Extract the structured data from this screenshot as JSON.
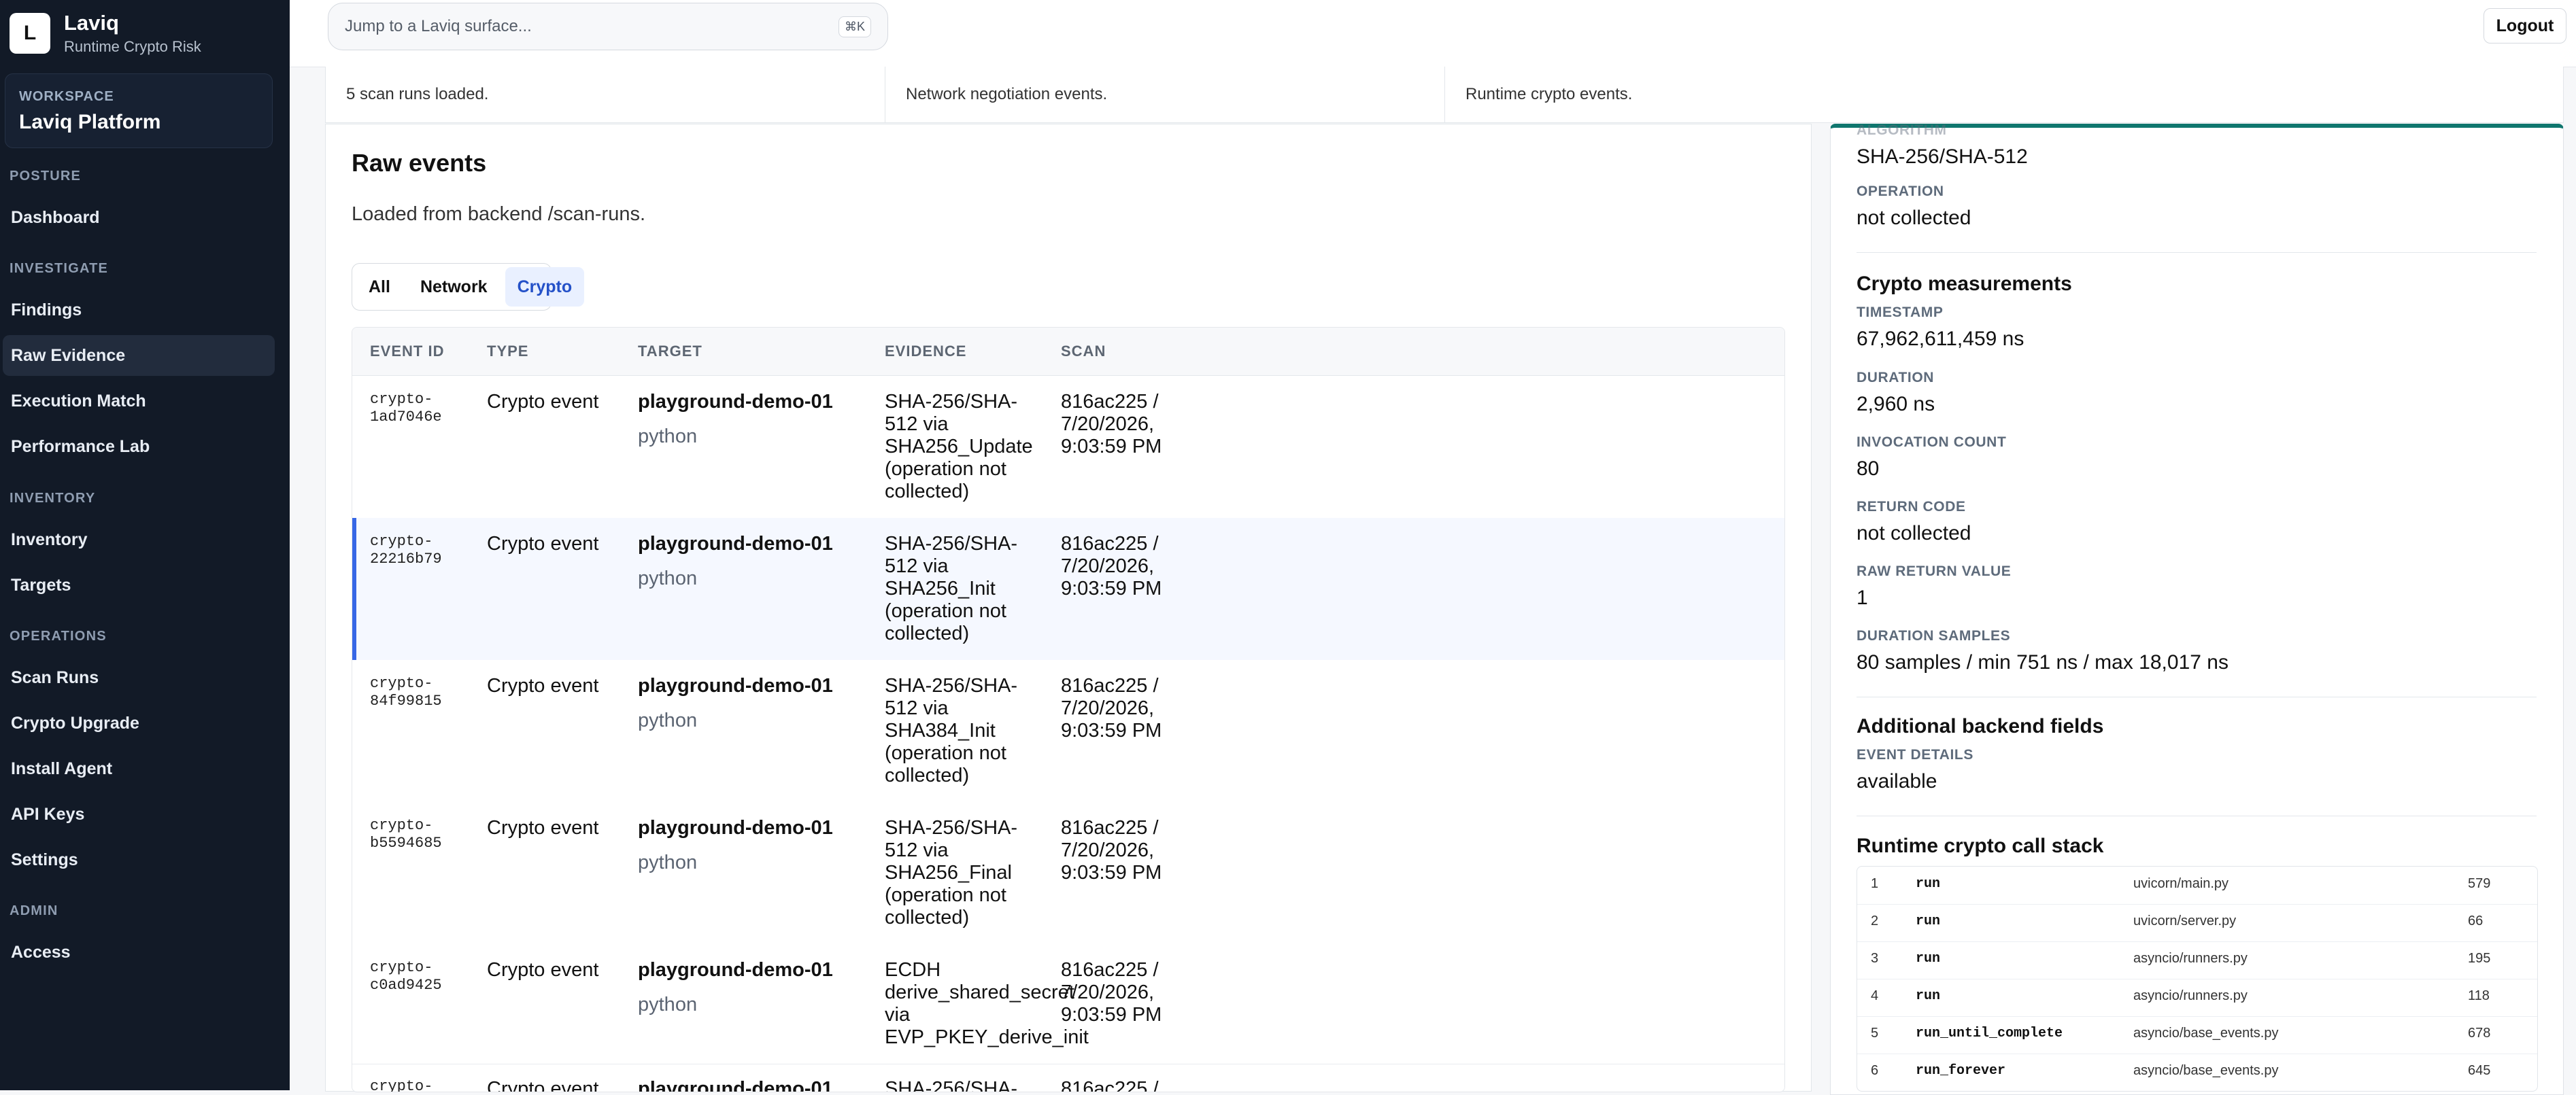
{
  "brand": {
    "logo_letter": "L",
    "name": "Laviq",
    "subtitle": "Runtime Crypto Risk"
  },
  "workspace": {
    "label": "WORKSPACE",
    "name": "Laviq Platform"
  },
  "sidebar": {
    "sections": [
      {
        "label": "POSTURE",
        "items": [
          {
            "label": "Dashboard"
          }
        ]
      },
      {
        "label": "INVESTIGATE",
        "items": [
          {
            "label": "Findings"
          },
          {
            "label": "Raw Evidence"
          },
          {
            "label": "Execution Match"
          },
          {
            "label": "Performance Lab"
          }
        ]
      },
      {
        "label": "INVENTORY",
        "items": [
          {
            "label": "Inventory"
          },
          {
            "label": "Targets"
          }
        ]
      },
      {
        "label": "OPERATIONS",
        "items": [
          {
            "label": "Scan Runs"
          },
          {
            "label": "Crypto Upgrade"
          },
          {
            "label": "Install Agent"
          },
          {
            "label": "API Keys"
          },
          {
            "label": "Settings"
          }
        ]
      },
      {
        "label": "ADMIN",
        "items": [
          {
            "label": "Access"
          }
        ]
      }
    ]
  },
  "topbar": {
    "search_placeholder": "Jump to a Laviq surface...",
    "shortcut": "⌘K",
    "logout": "Logout"
  },
  "stats": [
    {
      "text": "5 scan runs loaded."
    },
    {
      "text": "Network negotiation events."
    },
    {
      "text": "Runtime crypto events."
    }
  ],
  "raw_events": {
    "title": "Raw events",
    "subtitle": "Loaded from backend /scan-runs.",
    "filters": [
      {
        "label": "All"
      },
      {
        "label": "Network"
      },
      {
        "label": "Crypto",
        "active": true
      }
    ],
    "columns": [
      "EVENT ID",
      "TYPE",
      "TARGET",
      "EVIDENCE",
      "SCAN"
    ],
    "rows": [
      {
        "id": "crypto-\n1ad7046e",
        "type": "Crypto event",
        "target": "playground-demo-01",
        "lang": "python",
        "evidence": "SHA-256/SHA-\n512 via\nSHA256_Update\n(operation not\ncollected)",
        "scan": "816ac225 /\n7/20/2026,\n9:03:59 PM"
      },
      {
        "id": "crypto-\n22216b79",
        "type": "Crypto event",
        "target": "playground-demo-01",
        "lang": "python",
        "evidence": "SHA-256/SHA-\n512 via\nSHA256_Init\n(operation not\ncollected)",
        "scan": "816ac225 /\n7/20/2026,\n9:03:59 PM",
        "selected": true
      },
      {
        "id": "crypto-\n84f99815",
        "type": "Crypto event",
        "target": "playground-demo-01",
        "lang": "python",
        "evidence": "SHA-256/SHA-\n512 via\nSHA384_Init\n(operation not\ncollected)",
        "scan": "816ac225 /\n7/20/2026,\n9:03:59 PM"
      },
      {
        "id": "crypto-\nb5594685",
        "type": "Crypto event",
        "target": "playground-demo-01",
        "lang": "python",
        "evidence": "SHA-256/SHA-\n512 via\nSHA256_Final\n(operation not\ncollected)",
        "scan": "816ac225 /\n7/20/2026,\n9:03:59 PM"
      },
      {
        "id": "crypto-\nc0ad9425",
        "type": "Crypto event",
        "target": "playground-demo-01",
        "lang": "python",
        "evidence": "ECDH\nderive_shared_secret\nvia\nEVP_PKEY_derive_init",
        "scan": "816ac225 /\n7/20/2026,\n9:03:59 PM"
      },
      {
        "id": "crypto-",
        "type": "Crypto event",
        "target": "playground-demo-01",
        "lang": "",
        "evidence": "SHA-256/SHA-",
        "scan": "816ac225 /"
      }
    ]
  },
  "details": {
    "algorithm_label": "ALGORITHM",
    "algorithm": "SHA-256/SHA-512",
    "operation_label": "OPERATION",
    "operation": "not collected",
    "measurements_title": "Crypto measurements",
    "timestamp_label": "TIMESTAMP",
    "timestamp": "67,962,611,459 ns",
    "duration_label": "DURATION",
    "duration": "2,960 ns",
    "invocation_label": "INVOCATION COUNT",
    "invocation": "80",
    "return_code_label": "RETURN CODE",
    "return_code": "not collected",
    "raw_return_label": "RAW RETURN VALUE",
    "raw_return": "1",
    "duration_samples_label": "DURATION SAMPLES",
    "duration_samples": "80 samples / min 751 ns / max 18,017 ns",
    "additional_title": "Additional backend fields",
    "event_details_label": "EVENT DETAILS",
    "event_details": "available",
    "stack_title": "Runtime crypto call stack",
    "stack": [
      {
        "idx": "1",
        "fn": "run",
        "file": "uvicorn/main.py",
        "line": "579"
      },
      {
        "idx": "2",
        "fn": "run",
        "file": "uvicorn/server.py",
        "line": "66"
      },
      {
        "idx": "3",
        "fn": "run",
        "file": "asyncio/runners.py",
        "line": "195"
      },
      {
        "idx": "4",
        "fn": "run",
        "file": "asyncio/runners.py",
        "line": "118"
      },
      {
        "idx": "5",
        "fn": "run_until_complete",
        "file": "asyncio/base_events.py",
        "line": "678"
      },
      {
        "idx": "6",
        "fn": "run_forever",
        "file": "asyncio/base_events.py",
        "line": "645"
      }
    ]
  }
}
